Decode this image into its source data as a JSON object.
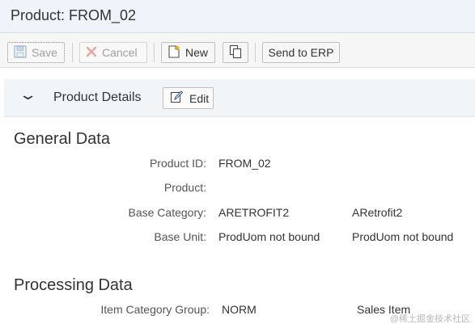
{
  "header": {
    "title": "Product: FROM_02"
  },
  "toolbar": {
    "save_label": "Save",
    "cancel_label": "Cancel",
    "new_label": "New",
    "send_label": "Send to ERP"
  },
  "section": {
    "title": "Product Details",
    "edit_label": "Edit"
  },
  "general": {
    "title": "General Data",
    "fields": [
      {
        "label": "Product ID:",
        "value": "FROM_02",
        "value2": ""
      },
      {
        "label": "Product:",
        "value": "",
        "value2": ""
      },
      {
        "label": "Base Category:",
        "value": "ARETROFIT2",
        "value2": "ARetrofit2"
      },
      {
        "label": "Base Unit:",
        "value": "ProdUom not bound",
        "value2": "ProdUom not bound"
      }
    ]
  },
  "processing": {
    "title": "Processing Data",
    "fields": [
      {
        "label": "Item Category Group:",
        "value": "NORM",
        "value2": "Sales Item"
      }
    ]
  },
  "watermark": "@稀土掘金技术社区"
}
